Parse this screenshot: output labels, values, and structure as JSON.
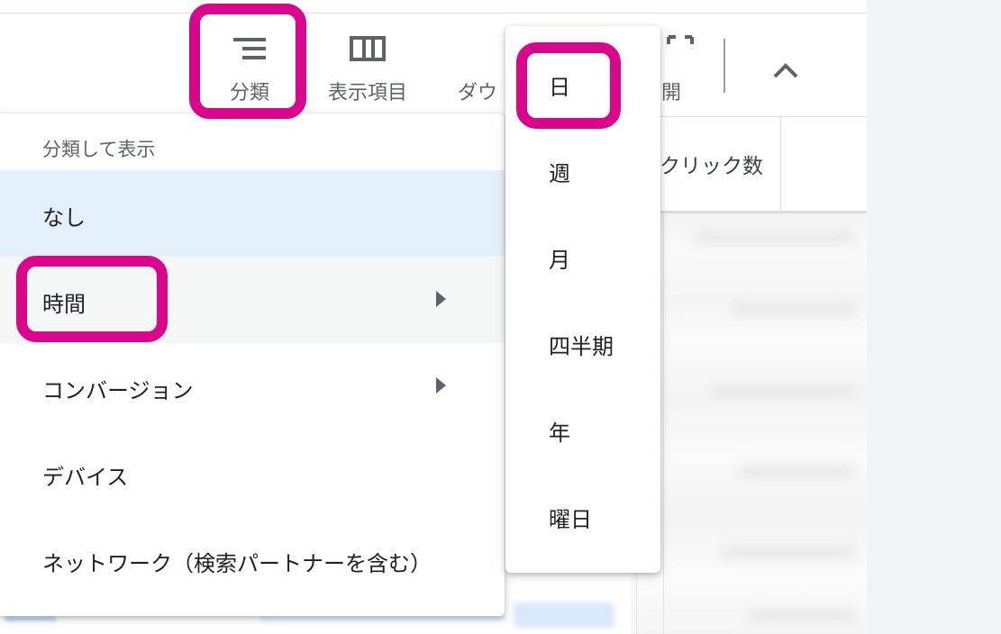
{
  "toolbar": {
    "segment_label": "分類",
    "columns_label": "表示項目",
    "download_label": "ダウ",
    "expand_label": "開"
  },
  "table": {
    "clicks_header": "クリック数"
  },
  "segment_menu": {
    "heading": "分類して表示",
    "items": [
      {
        "label": "なし",
        "has_submenu": false,
        "selected": true
      },
      {
        "label": "時間",
        "has_submenu": true,
        "hovered": true
      },
      {
        "label": "コンバージョン",
        "has_submenu": true
      },
      {
        "label": "デバイス",
        "has_submenu": false
      },
      {
        "label": "ネットワーク（検索パートナーを含む）",
        "has_submenu": false
      }
    ]
  },
  "time_submenu": {
    "items": [
      {
        "label": "日"
      },
      {
        "label": "週"
      },
      {
        "label": "月"
      },
      {
        "label": "四半期"
      },
      {
        "label": "年"
      },
      {
        "label": "曜日"
      }
    ]
  },
  "colors": {
    "highlight": "#d9068c",
    "selected_bg": "#e4effc",
    "hover_bg": "#f5f6f6",
    "link": "#1a73e8"
  },
  "icons": {
    "segment": "segment-lines-icon",
    "columns": "columns-icon",
    "expand": "fullscreen-icon",
    "collapse": "chevron-up-icon",
    "submenu_arrow": "arrow-right-icon"
  }
}
